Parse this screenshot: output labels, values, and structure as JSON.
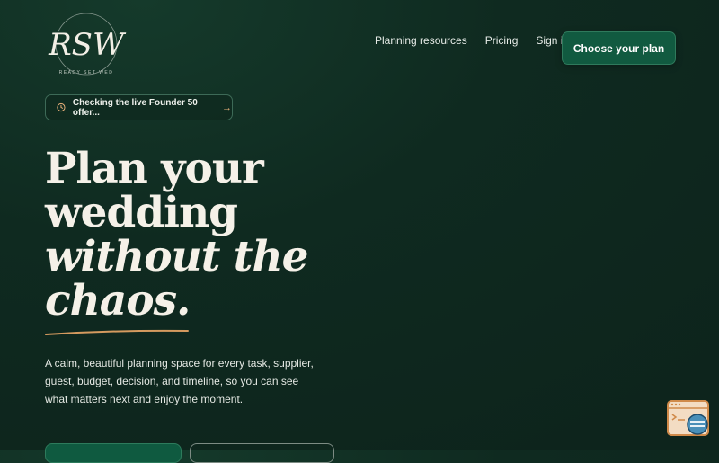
{
  "logo": {
    "initials": "RSW",
    "tagline": "READY SET WED"
  },
  "nav": {
    "items": [
      "Planning resources",
      "Pricing",
      "Sign in"
    ],
    "cta": "Choose your plan"
  },
  "offer_pill": {
    "text": "Checking the live Founder 50 offer..."
  },
  "hero": {
    "line1": "Plan your",
    "line2": "wedding",
    "line3": "without the",
    "line4": "chaos.",
    "lead": "A calm, beautiful planning space for every task, supplier, guest, budget, decision, and timeline, so you can see what matters next and enjoy the moment."
  },
  "colors": {
    "accent": "#d49a5f",
    "brand": "#115a40",
    "background": "#0f2a20"
  }
}
